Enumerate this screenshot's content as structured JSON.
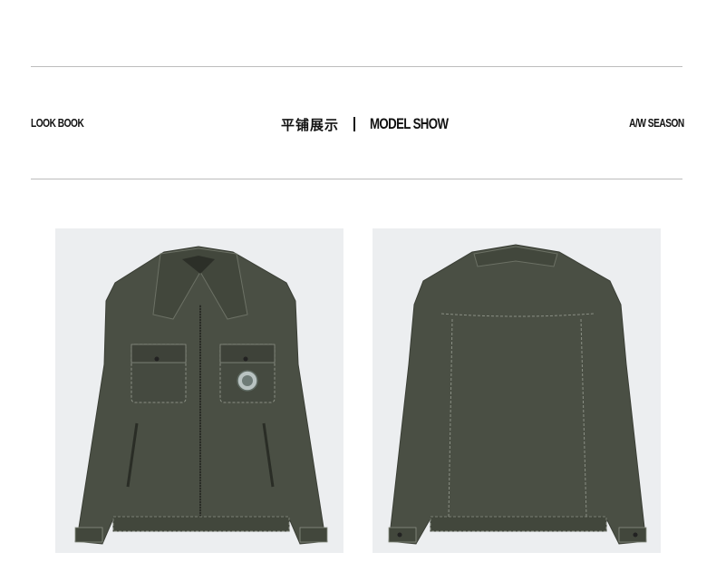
{
  "header": {
    "left_label": "LOOK BOOK",
    "center_chinese": "平铺展示",
    "center_english": "MODEL SHOW",
    "right_label": "A/W SEASON"
  },
  "products": [
    {
      "view": "front",
      "type": "jacket-front-image",
      "color": "#4a4f44"
    },
    {
      "view": "back",
      "type": "jacket-back-image",
      "color": "#4a4f44"
    }
  ],
  "colors": {
    "background": "#ffffff",
    "photo_background": "#eceef0",
    "jacket": "#4a4f44",
    "stitching": "#8a8f84",
    "rule": "#bdbdbd"
  }
}
